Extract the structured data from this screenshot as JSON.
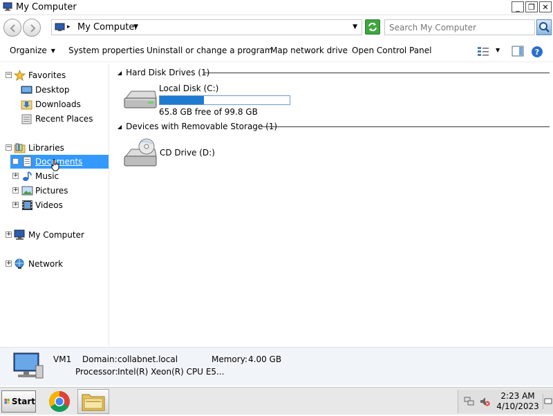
{
  "window": {
    "title": "My Computer",
    "controls": {
      "minimize": "_",
      "maximize": "❐",
      "close": "✕"
    }
  },
  "address_bar": {
    "location": "My Computer",
    "search_placeholder": "Search My Computer"
  },
  "command_bar": {
    "organize": "Organize",
    "system_properties": "System properties",
    "uninstall": "Uninstall or change a program",
    "map_drive": "Map network drive",
    "control_panel": "Open Control Panel"
  },
  "nav_pane": {
    "favorites": {
      "label": "Favorites",
      "items": [
        {
          "label": "Desktop",
          "icon": "desktop-icon"
        },
        {
          "label": "Downloads",
          "icon": "downloads-folder-icon"
        },
        {
          "label": "Recent Places",
          "icon": "recent-places-icon"
        }
      ]
    },
    "libraries": {
      "label": "Libraries",
      "items": [
        {
          "label": "Documents",
          "icon": "documents-icon",
          "selected": true
        },
        {
          "label": "Music",
          "icon": "music-icon"
        },
        {
          "label": "Pictures",
          "icon": "pictures-icon"
        },
        {
          "label": "Videos",
          "icon": "videos-icon"
        }
      ]
    },
    "my_computer": "My Computer",
    "network": "Network"
  },
  "content": {
    "hard_disk_group": "Hard Disk Drives (1)",
    "removable_group": "Devices with Removable Storage (1)",
    "local_disk": {
      "name": "Local Disk (C:)",
      "free_text": "65.8 GB free of 99.8 GB",
      "used_fraction": 0.34
    },
    "cd_drive": {
      "name": "CD Drive (D:)"
    }
  },
  "details": {
    "name": "VM1",
    "domain_label": "Domain:",
    "domain_value": "collabnet.local",
    "memory_label": "Memory:",
    "memory_value": "4.00 GB",
    "processor_label": "Processor:",
    "processor_value": "Intel(R) Xeon(R) CPU E5..."
  },
  "taskbar": {
    "start": "Start",
    "time": "2:23 AM",
    "date": "4/10/2023"
  },
  "colors": {
    "selection": "#3399ff",
    "disk_bar": "#1f7ad1"
  }
}
